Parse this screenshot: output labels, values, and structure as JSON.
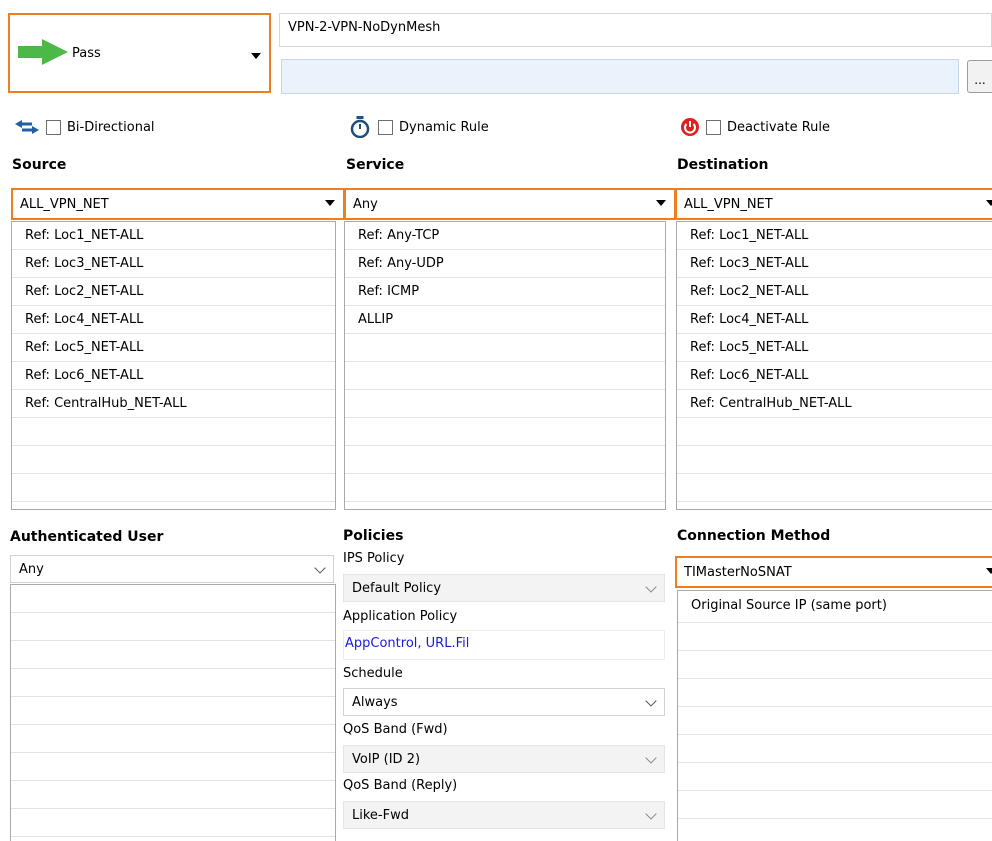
{
  "action": {
    "label": "Pass"
  },
  "rule": {
    "name": "VPN-2-VPN-NoDynMesh",
    "more_label": "..."
  },
  "options": {
    "bidirectional": "Bi-Directional",
    "dynamic_rule": "Dynamic Rule",
    "deactivate_rule": "Deactivate Rule"
  },
  "source": {
    "heading": "Source",
    "selected": "ALL_VPN_NET",
    "items": [
      "Ref: Loc1_NET-ALL",
      "Ref: Loc3_NET-ALL",
      "Ref: Loc2_NET-ALL",
      "Ref: Loc4_NET-ALL",
      "Ref: Loc5_NET-ALL",
      "Ref: Loc6_NET-ALL",
      "Ref: CentralHub_NET-ALL"
    ]
  },
  "service": {
    "heading": "Service",
    "selected": "Any",
    "items": [
      "Ref: Any-TCP",
      "Ref: Any-UDP",
      "Ref: ICMP",
      "ALLIP"
    ]
  },
  "destination": {
    "heading": "Destination",
    "selected": "ALL_VPN_NET",
    "items": [
      "Ref: Loc1_NET-ALL",
      "Ref: Loc3_NET-ALL",
      "Ref: Loc2_NET-ALL",
      "Ref: Loc4_NET-ALL",
      "Ref: Loc5_NET-ALL",
      "Ref: Loc6_NET-ALL",
      "Ref: CentralHub_NET-ALL"
    ]
  },
  "auth_user": {
    "heading": "Authenticated User",
    "selected": "Any"
  },
  "policies": {
    "heading": "Policies",
    "ips_label": "IPS Policy",
    "ips_value": "Default Policy",
    "app_label": "Application Policy",
    "app_value": "AppControl, URL.Fil",
    "schedule_label": "Schedule",
    "schedule_value": "Always",
    "qos_fwd_label": "QoS Band (Fwd)",
    "qos_fwd_value": "VoIP (ID 2)",
    "qos_reply_label": "QoS Band (Reply)",
    "qos_reply_value": "Like-Fwd"
  },
  "connection": {
    "heading": "Connection Method",
    "selected": "TIMasterNoSNAT",
    "items": [
      "Original Source IP (same port)"
    ]
  },
  "colors": {
    "accent": "#f07d1e",
    "pass_green": "#4cb848",
    "link_blue": "#1a1ae0",
    "deactivate_red": "#e02020"
  }
}
